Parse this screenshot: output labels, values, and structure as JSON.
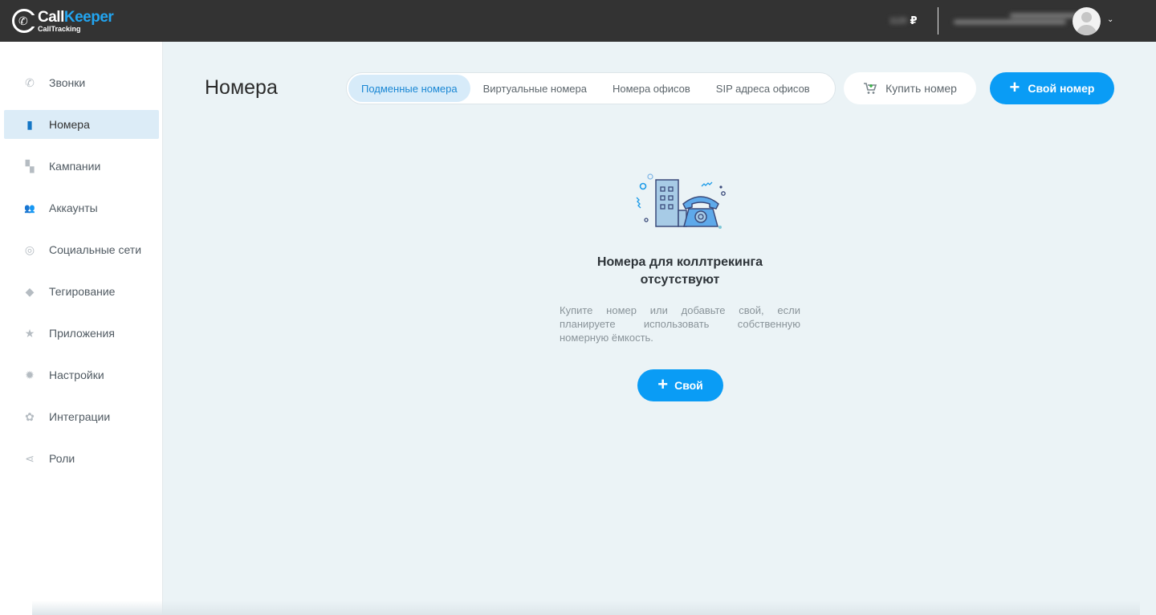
{
  "brand": {
    "name_part1": "Call",
    "name_part2": "Keeper",
    "subtitle": "CallTracking"
  },
  "header": {
    "balance_value": "1120",
    "currency": "₽",
    "chevron": "⌄"
  },
  "sidebar": {
    "items": [
      {
        "label": "Звонки",
        "icon": "phone-icon",
        "glyph": "✆"
      },
      {
        "label": "Номера",
        "icon": "numbers-book-icon",
        "glyph": "▮",
        "active": true
      },
      {
        "label": "Кампании",
        "icon": "campaigns-icon",
        "glyph": "▚"
      },
      {
        "label": "Аккаунты",
        "icon": "users-icon",
        "glyph": "👥"
      },
      {
        "label": "Социальные сети",
        "icon": "globe-icon",
        "glyph": "◎"
      },
      {
        "label": "Тегирование",
        "icon": "tags-icon",
        "glyph": "◆"
      },
      {
        "label": "Приложения",
        "icon": "star-icon",
        "glyph": "★"
      },
      {
        "label": "Настройки",
        "icon": "gear-icon",
        "glyph": "✹"
      },
      {
        "label": "Интеграции",
        "icon": "integrations-icon",
        "glyph": "✿"
      },
      {
        "label": "Роли",
        "icon": "share-icon",
        "glyph": "⋖"
      }
    ]
  },
  "main": {
    "title": "Номера",
    "tabs": [
      {
        "label": "Подменные номера",
        "active": true
      },
      {
        "label": "Виртуальные номера"
      },
      {
        "label": "Номера офисов"
      },
      {
        "label": "SIP адреса офисов"
      }
    ],
    "buy_button": "Купить номер",
    "own_button": "Свой номер",
    "empty_state": {
      "title_line1": "Номера для коллтрекинга",
      "title_line2": "отсутствуют",
      "description": "Купите номер или добавьте свой, если планируете использовать собственную номерную ёмкость.",
      "button": "Свой"
    }
  },
  "colors": {
    "accent": "#0a9cf5",
    "topbar": "#333333",
    "background": "#ebf3f6"
  }
}
